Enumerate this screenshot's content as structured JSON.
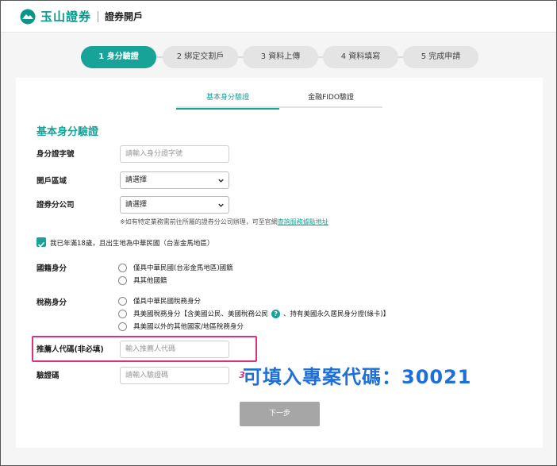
{
  "header": {
    "brand": "玉山證券",
    "section": "證券開戶"
  },
  "steps": [
    {
      "label": "1 身分驗證",
      "active": true
    },
    {
      "label": "2 綁定交割戶",
      "active": false
    },
    {
      "label": "3 資料上傳",
      "active": false
    },
    {
      "label": "4 資料填寫",
      "active": false
    },
    {
      "label": "5 完成申請",
      "active": false
    }
  ],
  "tabs": {
    "basic": "基本身分驗證",
    "fido": "金融FIDO驗證"
  },
  "form": {
    "title": "基本身分驗證",
    "id_label": "身分證字號",
    "id_placeholder": "請輸入身分證字號",
    "region_label": "開戶區域",
    "region_value": "請選擇",
    "branch_label": "證券分公司",
    "branch_value": "請選擇",
    "note_prefix": "※如有特定業務需前往所屬的證券分公司辦理，可至官網",
    "note_link": "查詢服務據點地址",
    "age_check": "我已年滿18歲，且出生地為中華民國（台澎金馬地區）",
    "nationality_label": "國籍身分",
    "nationality_opt1": "僅具中華民國(台澎金馬地區)國籍",
    "nationality_opt2": "具其他國籍",
    "tax_label": "稅務身分",
    "tax_opt1": "僅具中華民國稅務身分",
    "tax_opt2_a": "具美國稅務身分【含美國公民、美國稅務公民",
    "tax_opt2_help": "?",
    "tax_opt2_b": "、持有美國永久居民身分證(綠卡)】",
    "tax_opt3": "具美國以外的其他國家/地區稅務身分",
    "referrer_label": "推薦人代碼(非必填)",
    "referrer_placeholder": "輸入推薦人代碼",
    "captcha_label": "驗證碼",
    "captcha_placeholder": "請輸入驗證碼",
    "captcha_image_text": "3",
    "next_button": "下一步"
  },
  "annotation": "可填入專案代碼：30021",
  "colors": {
    "brand": "#17a398",
    "highlight": "#d63384",
    "annotation": "#1e6fd9"
  }
}
